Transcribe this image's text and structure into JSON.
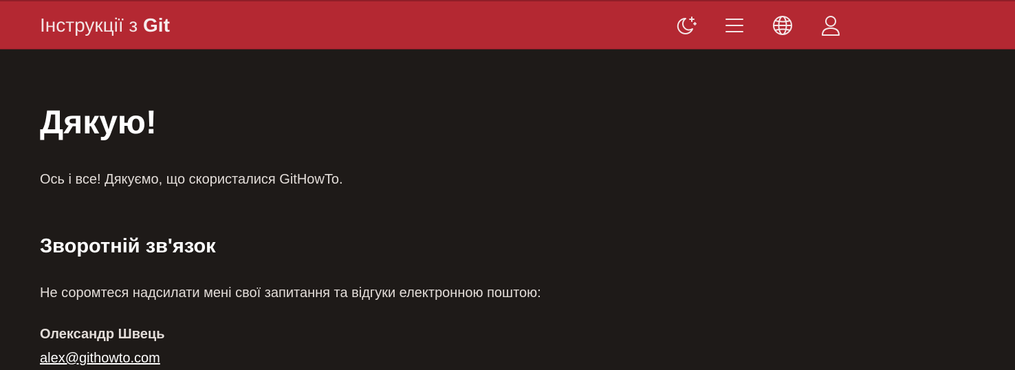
{
  "header": {
    "title_prefix": "Інструкції з",
    "title_strong": "Git",
    "icons": [
      "theme-toggle-icon",
      "menu-icon",
      "language-icon",
      "user-icon"
    ],
    "background": "#b42832"
  },
  "main": {
    "heading": "Дякую!",
    "intro": "Ось і все! Дякуємо, що скористалися GitHowTo.",
    "feedback_heading": "Зворотній зв'язок",
    "feedback_text": "Не соромтеся надсилати мені свої запитання та відгуки електронною поштою:",
    "author_name": "Олександр Швець",
    "email": "alex@githowto.com"
  }
}
